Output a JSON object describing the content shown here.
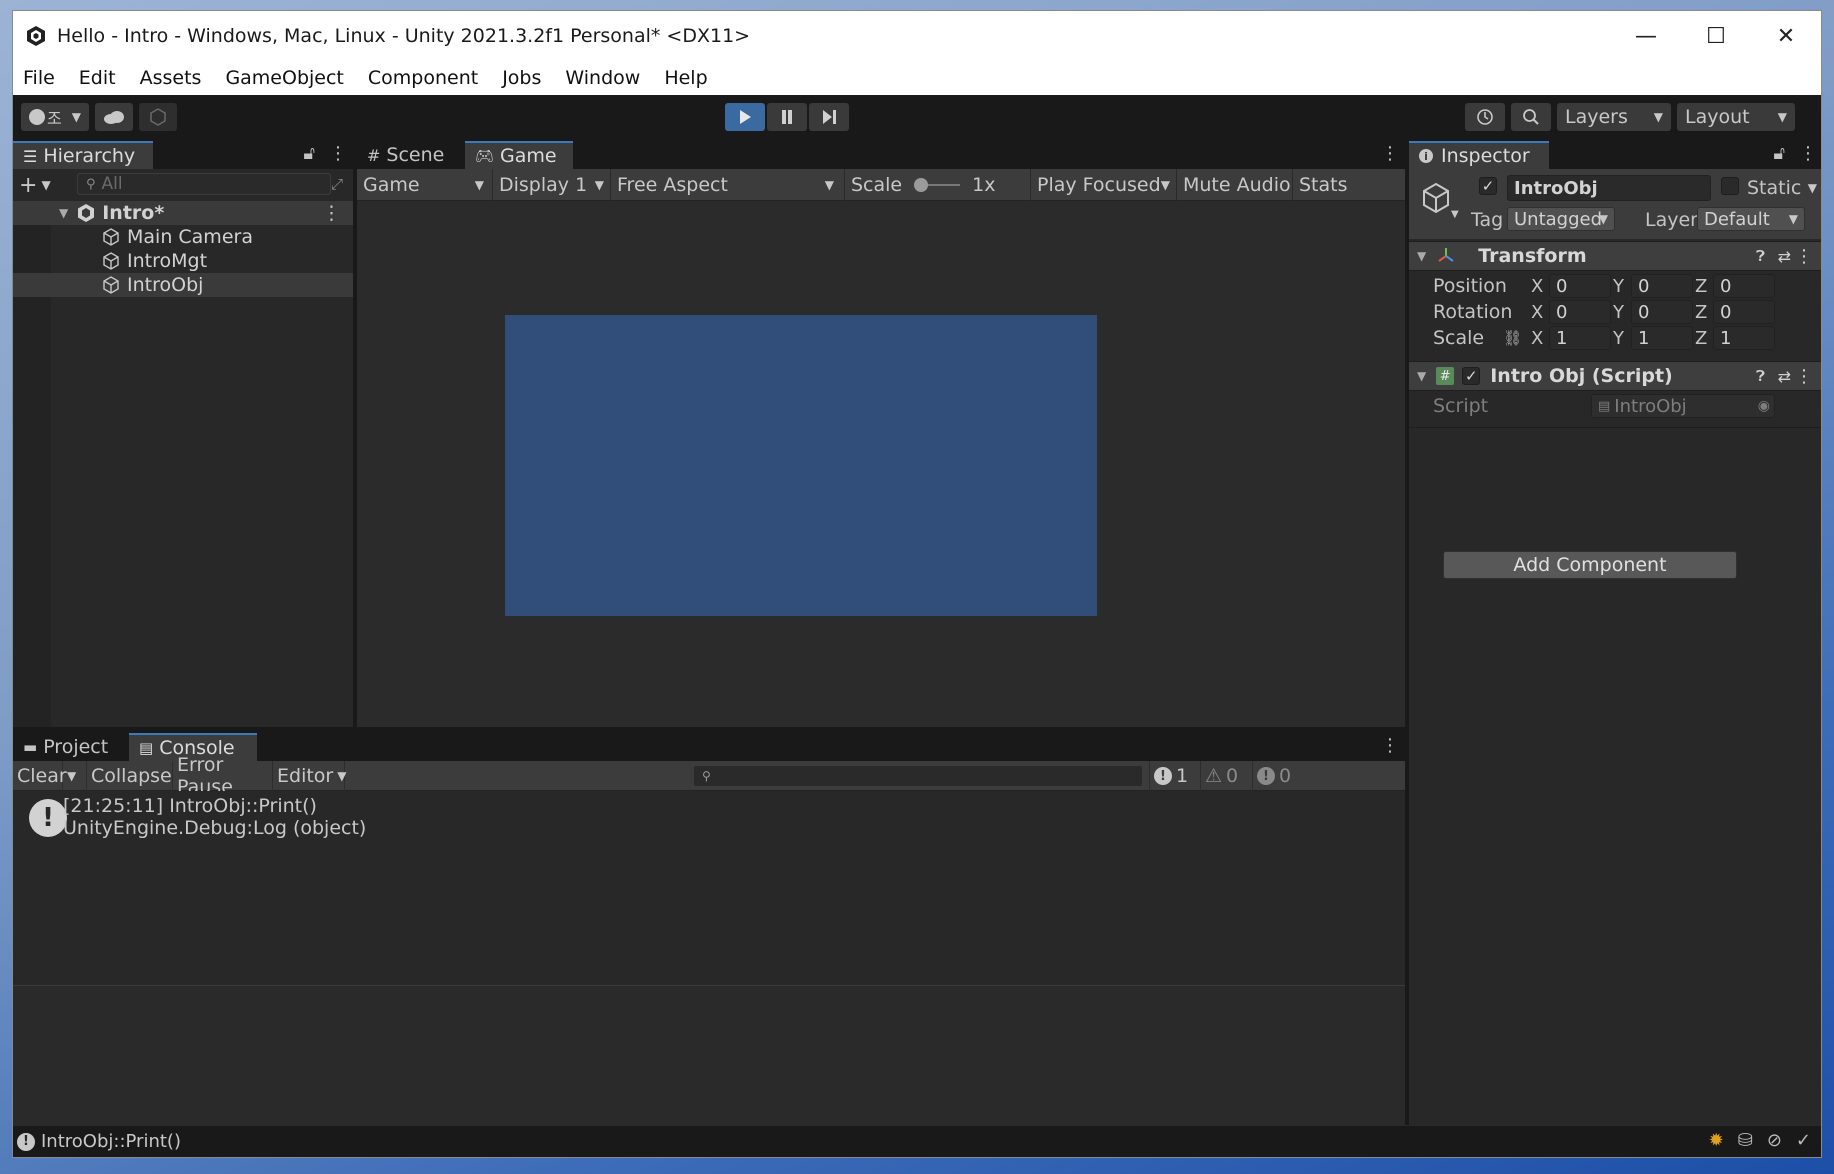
{
  "window": {
    "title": "Hello - Intro - Windows, Mac, Linux - Unity 2021.3.2f1 Personal* <DX11>",
    "minimize_glyph": "—",
    "maximize_glyph": "☐",
    "close_glyph": "✕"
  },
  "menu": [
    "File",
    "Edit",
    "Assets",
    "GameObject",
    "Component",
    "Jobs",
    "Window",
    "Help"
  ],
  "toolbar": {
    "account_initial": "조",
    "layers_label": "Layers",
    "layout_label": "Layout",
    "play_icon": "play-icon",
    "pause_icon": "pause-icon",
    "step_icon": "step-icon"
  },
  "hierarchy": {
    "tab_label": "Hierarchy",
    "search_placeholder": "All",
    "scene_name": "Intro*",
    "objects": [
      "Main Camera",
      "IntroMgt",
      "IntroObj"
    ],
    "selected_index": 2
  },
  "scene_game": {
    "scene_tab": "Scene",
    "game_tab": "Game",
    "game_dropdown": "Game",
    "display_dropdown": "Display 1",
    "aspect_dropdown": "Free Aspect",
    "scale_label": "Scale",
    "scale_value": "1x",
    "play_focused": "Play Focused",
    "mute_audio": "Mute Audio",
    "stats": "Stats",
    "game_bg_color": "#314d79"
  },
  "inspector": {
    "tab_label": "Inspector",
    "object_name": "IntroObj",
    "static_label": "Static",
    "tag_label": "Tag",
    "tag_value": "Untagged",
    "layer_label": "Layer",
    "layer_value": "Default",
    "transform": {
      "header": "Transform",
      "position_label": "Position",
      "rotation_label": "Rotation",
      "scale_label": "Scale",
      "position": [
        "0",
        "0",
        "0"
      ],
      "rotation": [
        "0",
        "0",
        "0"
      ],
      "scale": [
        "1",
        "1",
        "1"
      ],
      "axis_x": "X",
      "axis_y": "Y",
      "axis_z": "Z"
    },
    "script_component": {
      "header": "Intro Obj (Script)",
      "script_label": "Script",
      "script_value": "IntroObj"
    },
    "add_component": "Add Component"
  },
  "console": {
    "project_tab": "Project",
    "console_tab": "Console",
    "clear": "Clear",
    "collapse": "Collapse",
    "error_pause": "Error Pause",
    "editor": "Editor",
    "count_log": "1",
    "count_warn": "0",
    "count_error": "0",
    "entries": [
      {
        "line1": "[21:25:11] IntroObj::Print()",
        "line2": "UnityEngine.Debug:Log (object)"
      }
    ]
  },
  "status": {
    "message": "IntroObj::Print()"
  }
}
